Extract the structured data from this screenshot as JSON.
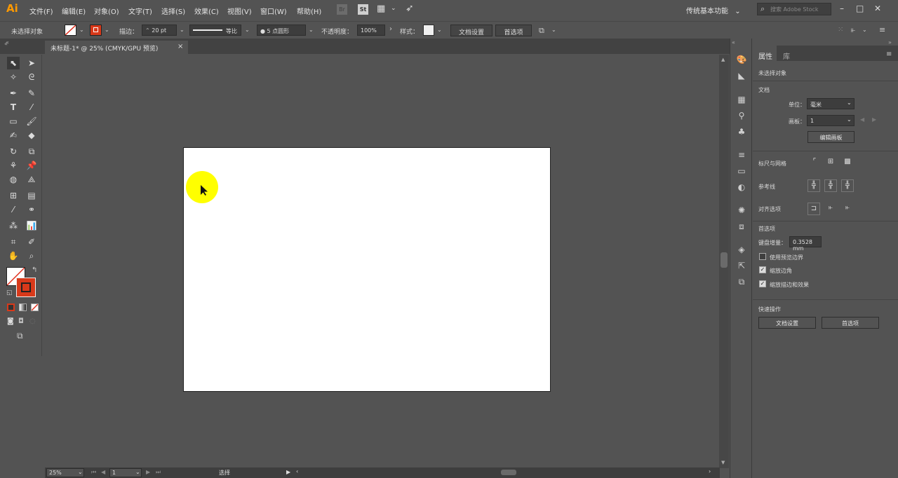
{
  "app": {
    "logo": "Ai"
  },
  "menu": [
    "文件(F)",
    "编辑(E)",
    "对象(O)",
    "文字(T)",
    "选择(S)",
    "效果(C)",
    "视图(V)",
    "窗口(W)",
    "帮助(H)"
  ],
  "menu_icons": {
    "bridge": "Br",
    "stock": "St",
    "arrange": "▦",
    "gpu": "➶"
  },
  "workspace": {
    "label": "传统基本功能",
    "chevron": "⌄"
  },
  "search": {
    "placeholder": "搜索 Adobe Stock",
    "icon": "⌕"
  },
  "window_controls": {
    "minimize": "–",
    "restore": "□",
    "close": "✕"
  },
  "control_bar": {
    "no_selection": "未选择对象",
    "stroke_label": "描边：",
    "stroke_value": "20 pt",
    "stroke_profile": "等比",
    "brush": "● 5 点圆形",
    "opacity_label": "不透明度：",
    "opacity_value": "100%",
    "style_label": "样式：",
    "doc_setup": "文档设置",
    "preferences": "首选项"
  },
  "document_tab": {
    "title": "未标题-1* @ 25% (CMYK/GPU 预览)",
    "close": "×"
  },
  "status_bar": {
    "zoom": "25%",
    "artboard": "1",
    "mode": "选择"
  },
  "properties_panel": {
    "tab_properties": "属性",
    "tab_library": "库",
    "no_selection": "未选择对象",
    "document_heading": "文档",
    "units_label": "单位：",
    "units_value": "毫米",
    "artboard_label": "画板：",
    "artboard_value": "1",
    "edit_artboards": "编辑画板",
    "rulers_grids": "标尺与网格",
    "guides": "参考线",
    "align_options": "对齐选项",
    "preferences_heading": "首选项",
    "keyboard_increment_label": "键盘增量：",
    "keyboard_increment_value": "0.3528 mm",
    "use_preview_bounds": "使用预览边界",
    "scale_corners": "缩放边角",
    "scale_strokes_effects": "缩放描边和效果",
    "checkbox_states": {
      "use_preview_bounds": false,
      "scale_corners": true,
      "scale_strokes_effects": true
    },
    "quick_actions_heading": "快速操作",
    "doc_setup_button": "文档设置",
    "preferences_button": "首选项"
  },
  "colors": {
    "ui_background": "#535353",
    "panel_dark": "#424242",
    "artboard": "#ffffff",
    "cursor_highlight": "#ffff00",
    "logo_orange": "#ff9a00",
    "stroke_red": "#d8391a"
  }
}
